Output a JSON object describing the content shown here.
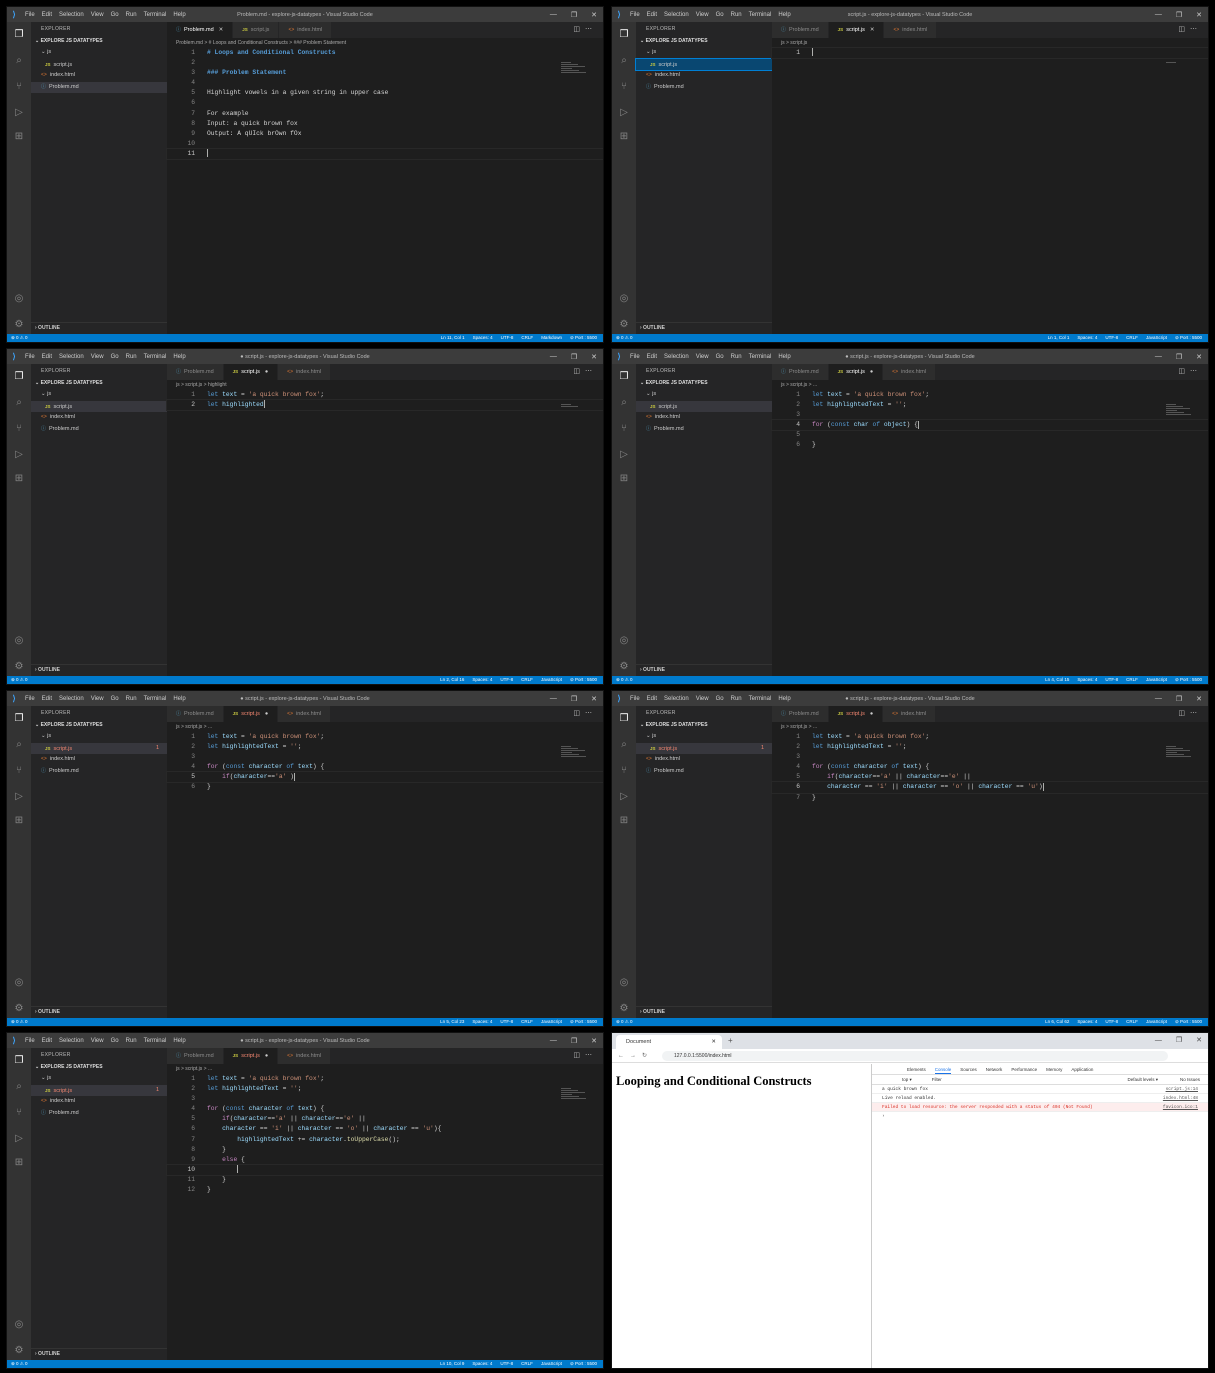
{
  "menu": [
    "File",
    "Edit",
    "Selection",
    "View",
    "Go",
    "Run",
    "Terminal",
    "Help"
  ],
  "explorer": {
    "header": "EXPLORER",
    "project": "EXPLORE JS DATATYPES",
    "folder": "js",
    "files": [
      "script.js",
      "index.html",
      "Problem.md"
    ],
    "outline": "OUTLINE",
    "error_count": "1"
  },
  "tabs": {
    "problem": "Problem.md",
    "script": "script.js",
    "index": "index.html"
  },
  "panels": [
    {
      "title": "Problem.md - explore-js-datatypes - Visual Studio Code",
      "active_tab": "problem",
      "breadcrumb": "Problem.md > # Loops and Conditional Constructs > ### Problem Statement",
      "status_pos": "Ln 11, Col 1",
      "lang": "Markdown",
      "lines": [
        "# Loops and Conditional Constructs",
        "",
        "### Problem Statement",
        "",
        "Highlight vowels in a given string in upper case",
        "",
        "For example",
        "Input: a quick brown fox",
        "Output: A qUIck brOwn fOx",
        "",
        ""
      ]
    },
    {
      "title": "script.js - explore-js-datatypes - Visual Studio Code",
      "active_tab": "script",
      "breadcrumb": "js > script.js",
      "status_pos": "Ln 1, Col 1",
      "lang": "JavaScript",
      "lines": [
        ""
      ]
    },
    {
      "title": "● script.js - explore-js-datatypes - Visual Studio Code",
      "active_tab": "script",
      "breadcrumb": "js > script.js > highlight",
      "status_pos": "Ln 2, Col 16",
      "lang": "JavaScript",
      "lines": [
        "let text = 'a quick brown fox';",
        "let highlighted"
      ]
    },
    {
      "title": "● script.js - explore-js-datatypes - Visual Studio Code",
      "active_tab": "script",
      "breadcrumb": "js > script.js > ...",
      "status_pos": "Ln 4, Col 15",
      "lang": "JavaScript",
      "lines": [
        "let text = 'a quick brown fox';",
        "let highlightedText = '';",
        "",
        "for (const char of object) {",
        "",
        "}"
      ]
    },
    {
      "title": "● script.js - explore-js-datatypes - Visual Studio Code",
      "active_tab": "script",
      "breadcrumb": "js > script.js > ...",
      "status_pos": "Ln 5, Col 23",
      "lang": "JavaScript",
      "lines": [
        "let text = 'a quick brown fox';",
        "let highlightedText = '';",
        "",
        "for (const character of text) {",
        "    if(character=='a' )",
        "}"
      ]
    },
    {
      "title": "● script.js - explore-js-datatypes - Visual Studio Code",
      "active_tab": "script",
      "breadcrumb": "js > script.js > ...",
      "status_pos": "Ln 6, Col 62",
      "lang": "JavaScript",
      "lines": [
        "let text = 'a quick brown fox';",
        "let highlightedText = '';",
        "",
        "for (const character of text) {",
        "    if(character=='a' || character=='e' ||",
        "    character == 'i' || character == 'o' || character == 'u')",
        "}"
      ]
    },
    {
      "title": "● script.js - explore-js-datatypes - Visual Studio Code",
      "active_tab": "script",
      "breadcrumb": "js > script.js > ...",
      "status_pos": "Ln 10, Col 9",
      "lang": "JavaScript",
      "lines": [
        "let text = 'a quick brown fox';",
        "let highlightedText = '';",
        "",
        "for (const character of text) {",
        "    if(character=='a' || character=='e' ||",
        "    character == 'i' || character == 'o' || character == 'u'){",
        "        highlightedText += character.toUpperCase();",
        "    }",
        "    else {",
        "        ",
        "    }",
        "}"
      ]
    }
  ],
  "status_common": {
    "spaces": "Spaces: 4",
    "enc": "UTF-8",
    "eol": "CRLF",
    "port": "Port : 5500",
    "errs": "⊗ 0 ⚠ 0"
  },
  "browser": {
    "tab_title": "Document",
    "url": "127.0.0.1:5500/index.html",
    "heading": "Looping and Conditional Constructs",
    "devtools_tabs": [
      "Elements",
      "Console",
      "Sources",
      "Network",
      "Performance",
      "Memory",
      "Application"
    ],
    "context": "top ▾",
    "filter": "Filter",
    "levels": "Default levels ▾",
    "issues": "No Issues",
    "console": [
      {
        "text": "a quick brown fox",
        "src": "script.js:14",
        "type": "log"
      },
      {
        "text": "Live reload enabled.",
        "src": "index.html:48",
        "type": "log"
      },
      {
        "text": "Failed to load resource: the server responded with a status of 404 (Not Found)",
        "src": "favicon.ico:1",
        "type": "error"
      }
    ]
  }
}
